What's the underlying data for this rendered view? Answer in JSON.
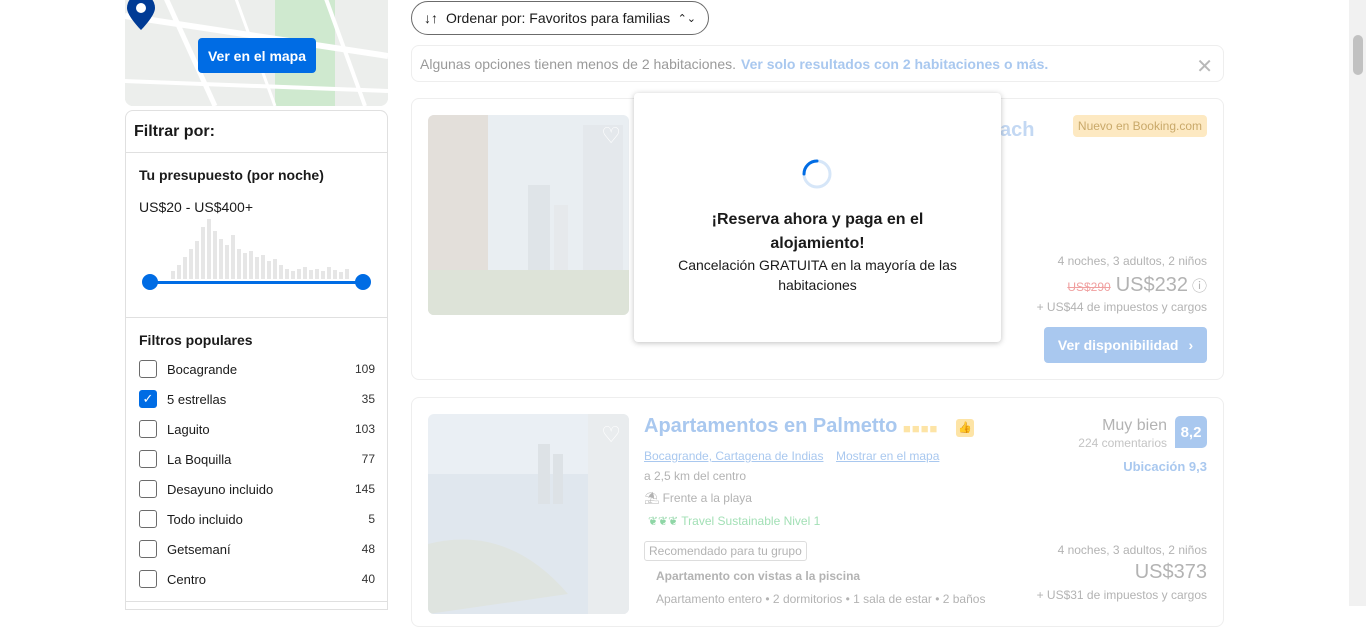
{
  "map": {
    "button_label": "Ver en el mapa"
  },
  "filters": {
    "title": "Filtrar por:",
    "budget_title": "Tu presupuesto (por noche)",
    "budget_range": "US$20 - US$400+",
    "popular_title": "Filtros populares",
    "items": [
      {
        "label": "Bocagrande",
        "count": "109",
        "checked": false
      },
      {
        "label": "5 estrellas",
        "count": "35",
        "checked": true
      },
      {
        "label": "Laguito",
        "count": "103",
        "checked": false
      },
      {
        "label": "La Boquilla",
        "count": "77",
        "checked": false
      },
      {
        "label": "Desayuno incluido",
        "count": "145",
        "checked": false
      },
      {
        "label": "Todo incluido",
        "count": "5",
        "checked": false
      },
      {
        "label": "Getsemaní",
        "count": "48",
        "checked": false
      },
      {
        "label": "Centro",
        "count": "40",
        "checked": false
      }
    ]
  },
  "sort": {
    "label": "Ordenar por: Favoritos para familias"
  },
  "notice": {
    "text": "Algunas opciones tienen menos de 2 habitaciones.",
    "link": "Ver solo resultados con 2 habitaciones o más."
  },
  "card1": {
    "name_partial": "ach",
    "badge": "Nuevo en Booking.com",
    "stay": "4 noches, 3 adultos, 2 niños",
    "old_price": "US$290",
    "price": "US$232",
    "taxes": "+ US$44 de impuestos y cargos",
    "button": "Ver disponibilidad"
  },
  "card2": {
    "name": "Apartamentos en Palmetto",
    "location": "Bocagrande, Cartagena de Indias",
    "map_link": "Mostrar en el mapa",
    "distance": "a 2,5 km del centro",
    "beach": "Frente a la playa",
    "sustainable": "Travel Sustainable Nivel 1",
    "recommended": "Recomendado para tu grupo",
    "room": "Apartamento con vistas a la piscina",
    "room_details": "Apartamento entero • 2 dormitorios • 1 sala de estar • 2 baños",
    "review_word": "Muy bien",
    "review_count": "224 comentarios",
    "score": "8,2",
    "location_score": "Ubicación 9,3",
    "stay": "4 noches, 3 adultos, 2 niños",
    "price": "US$373",
    "taxes": "+ US$31 de impuestos y cargos"
  },
  "popup": {
    "title": "¡Reserva ahora y paga en el alojamiento!",
    "subtitle": "Cancelación GRATUITA en la mayoría de las habitaciones"
  },
  "colors": {
    "accent": "#006ce4",
    "faded_link": "#a9c8ef"
  }
}
